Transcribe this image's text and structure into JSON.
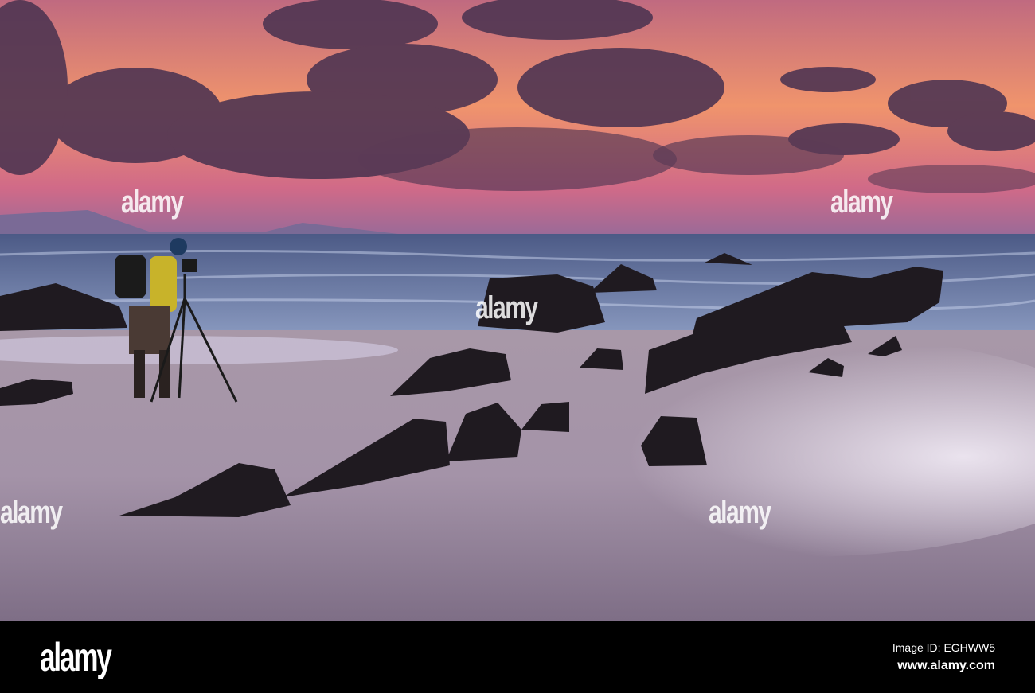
{
  "photo": {
    "subject": "photographer-with-tripod-on-beach-at-sunset",
    "colors": {
      "sky_top": "#c8607a",
      "sky_glow": "#f59a6a",
      "cloud": "#4a2f4c",
      "sea": "#5a6c94",
      "sand": "#9a8898",
      "sand_light": "#d8d0e4",
      "rock": "#1f1a20"
    }
  },
  "watermark": {
    "text": "alamy"
  },
  "footer": {
    "logo": "alamy",
    "image_id": "Image ID: EGHWW5",
    "website": "www.alamy.com"
  }
}
